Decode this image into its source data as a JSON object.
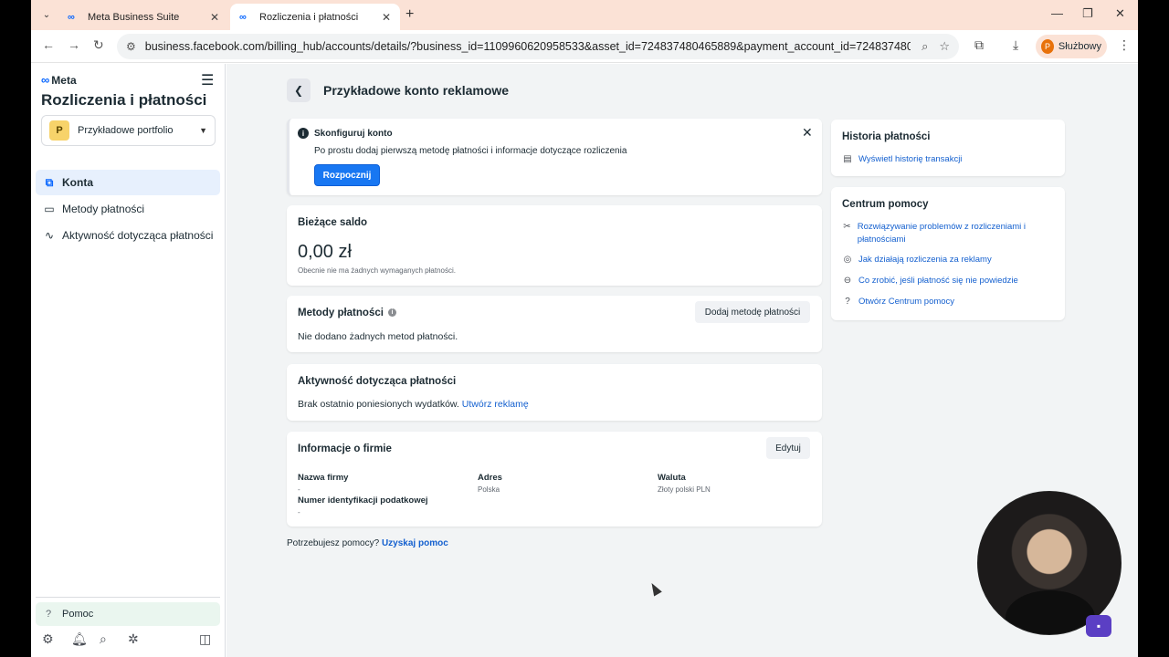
{
  "browser": {
    "tabs": [
      {
        "title": "Meta Business Suite",
        "active": false
      },
      {
        "title": "Rozliczenia i płatności",
        "active": true
      }
    ],
    "url": "business.facebook.com/billing_hub/accounts/details/?business_id=1109960620958533&asset_id=724837480465889&payment_account_id=724837480465889&entrypoi...",
    "profile_label": "Służbowy",
    "profile_initial": "P"
  },
  "sidebar": {
    "logo": "Meta",
    "title": "Rozliczenia i płatności",
    "portfolio": {
      "initial": "P",
      "name": "Przykładowe portfolio"
    },
    "items": [
      {
        "label": "Konta",
        "active": true,
        "icon": "accounts-icon"
      },
      {
        "label": "Metody płatności",
        "active": false,
        "icon": "credit-card-icon"
      },
      {
        "label": "Aktywność dotycząca płatności",
        "active": false,
        "icon": "activity-icon"
      }
    ],
    "help_label": "Pomoc"
  },
  "main": {
    "title": "Przykładowe konto reklamowe",
    "alert": {
      "heading": "Skonfiguruj konto",
      "text": "Po prostu dodaj pierwszą metodę płatności i informacje dotyczące rozliczenia",
      "button": "Rozpocznij"
    },
    "balance": {
      "heading": "Bieżące saldo",
      "amount": "0,00 zł",
      "note": "Obecnie nie ma żadnych wymaganych płatności."
    },
    "methods": {
      "heading": "Metody płatności",
      "button": "Dodaj metodę płatności",
      "empty": "Nie dodano żadnych metod płatności."
    },
    "activity": {
      "heading": "Aktywność dotycząca płatności",
      "text": "Brak ostatnio poniesionych wydatków.",
      "link": "Utwórz reklamę"
    },
    "company": {
      "heading": "Informacje o firmie",
      "edit": "Edytuj",
      "name_label": "Nazwa firmy",
      "name_value": "-",
      "tax_label": "Numer identyfikacji podatkowej",
      "tax_value": "-",
      "address_label": "Adres",
      "address_value": "Polska",
      "currency_label": "Waluta",
      "currency_value": "Złoty polski PLN"
    },
    "help_text": "Potrzebujesz pomocy?",
    "help_link": "Uzyskaj pomoc"
  },
  "right": {
    "history": {
      "heading": "Historia płatności",
      "link": "Wyświetl historię transakcji"
    },
    "help_center": {
      "heading": "Centrum pomocy",
      "links": [
        "Rozwiązywanie problemów z rozliczeniami i płatnościami",
        "Jak działają rozliczenia za reklamy",
        "Co zrobić, jeśli płatność się nie powiedzie",
        "Otwórz Centrum pomocy"
      ]
    }
  },
  "colors": {
    "accent": "#1877f2",
    "link": "#1460cf",
    "tabstrip": "#fbe2d6"
  }
}
